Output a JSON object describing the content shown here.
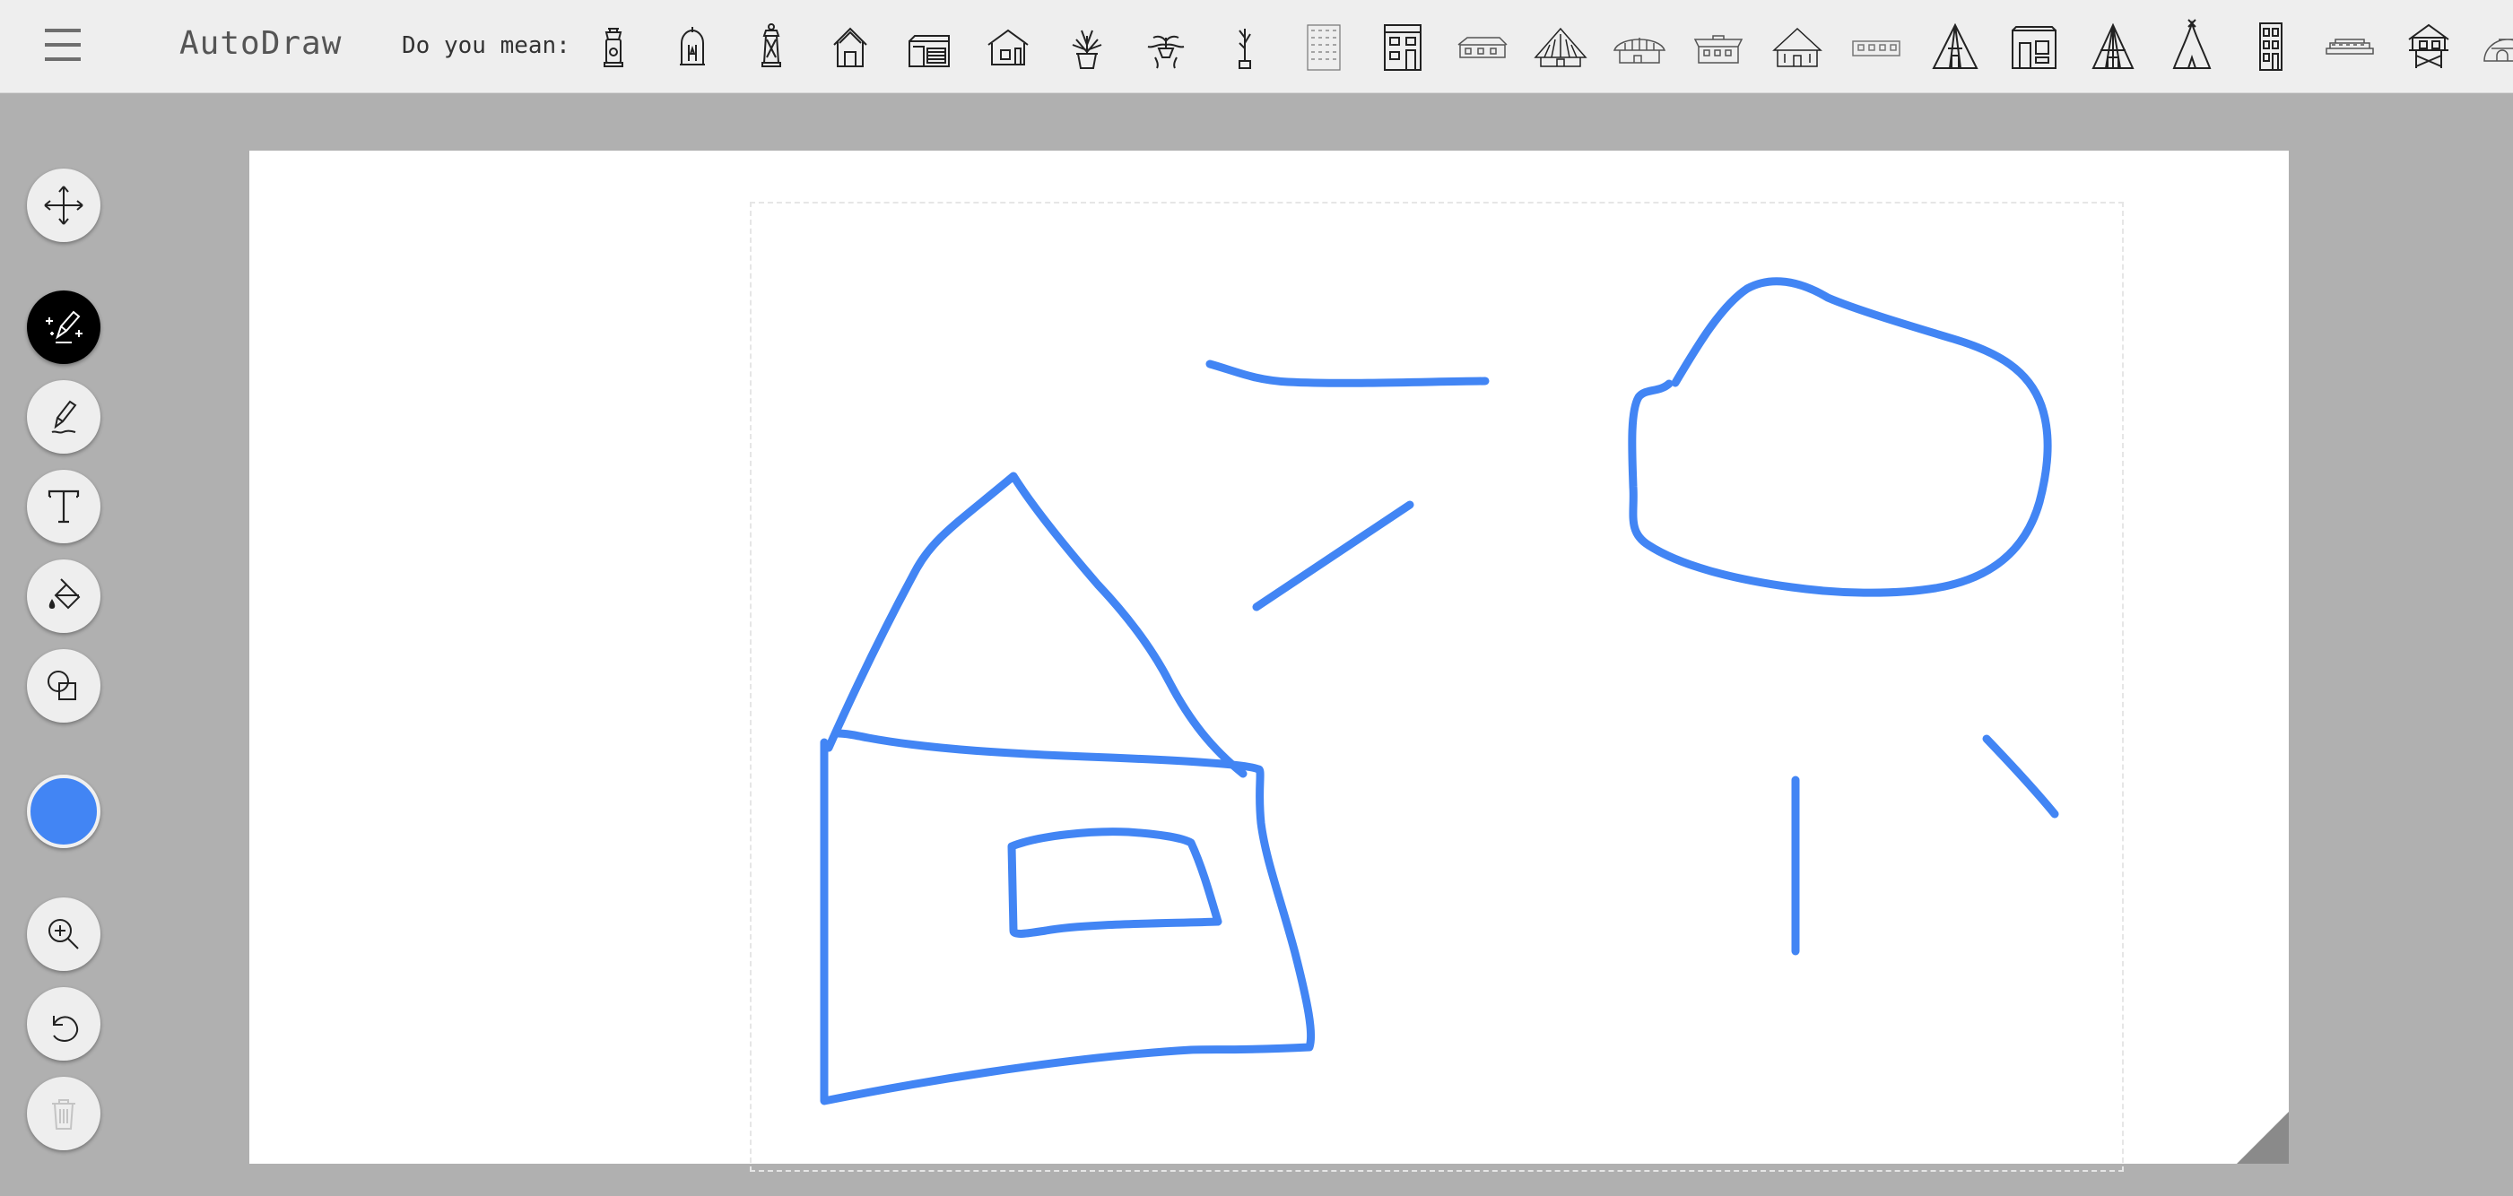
{
  "app": {
    "title": "AutoDraw",
    "menu_icon": "hamburger-menu-icon"
  },
  "suggestions": {
    "label": "Do you mean:",
    "items": [
      "lantern-icon",
      "lantern-icon",
      "lantern-icon",
      "house-icon",
      "house-icon",
      "house-icon",
      "potted-plant-icon",
      "potted-plant-icon",
      "plant-icon",
      "building-icon",
      "building-icon",
      "house-icon",
      "hut-icon",
      "hut-icon",
      "house-icon",
      "hut-icon",
      "house-icon",
      "tent-icon",
      "house-icon",
      "tent-icon",
      "tent-icon",
      "building-icon",
      "house-icon",
      "house-icon",
      "igloo-icon"
    ]
  },
  "toolbar": {
    "tools": [
      {
        "name": "select-tool",
        "icon": "move-arrows-icon",
        "active": false
      },
      {
        "name": "autodraw-tool",
        "icon": "magic-pencil-icon",
        "active": true
      },
      {
        "name": "draw-tool",
        "icon": "pencil-icon",
        "active": false
      },
      {
        "name": "type-tool",
        "icon": "text-icon",
        "active": false
      },
      {
        "name": "fill-tool",
        "icon": "paint-bucket-icon",
        "active": false
      },
      {
        "name": "shape-tool",
        "icon": "shapes-icon",
        "active": false
      }
    ],
    "color": "#4285f4",
    "actions": [
      {
        "name": "zoom-button",
        "icon": "zoom-in-icon"
      },
      {
        "name": "undo-button",
        "icon": "undo-icon"
      },
      {
        "name": "delete-button",
        "icon": "trash-icon",
        "disabled": true
      }
    ]
  },
  "canvas": {
    "background": "#ffffff",
    "stroke_color": "#4285f4"
  }
}
